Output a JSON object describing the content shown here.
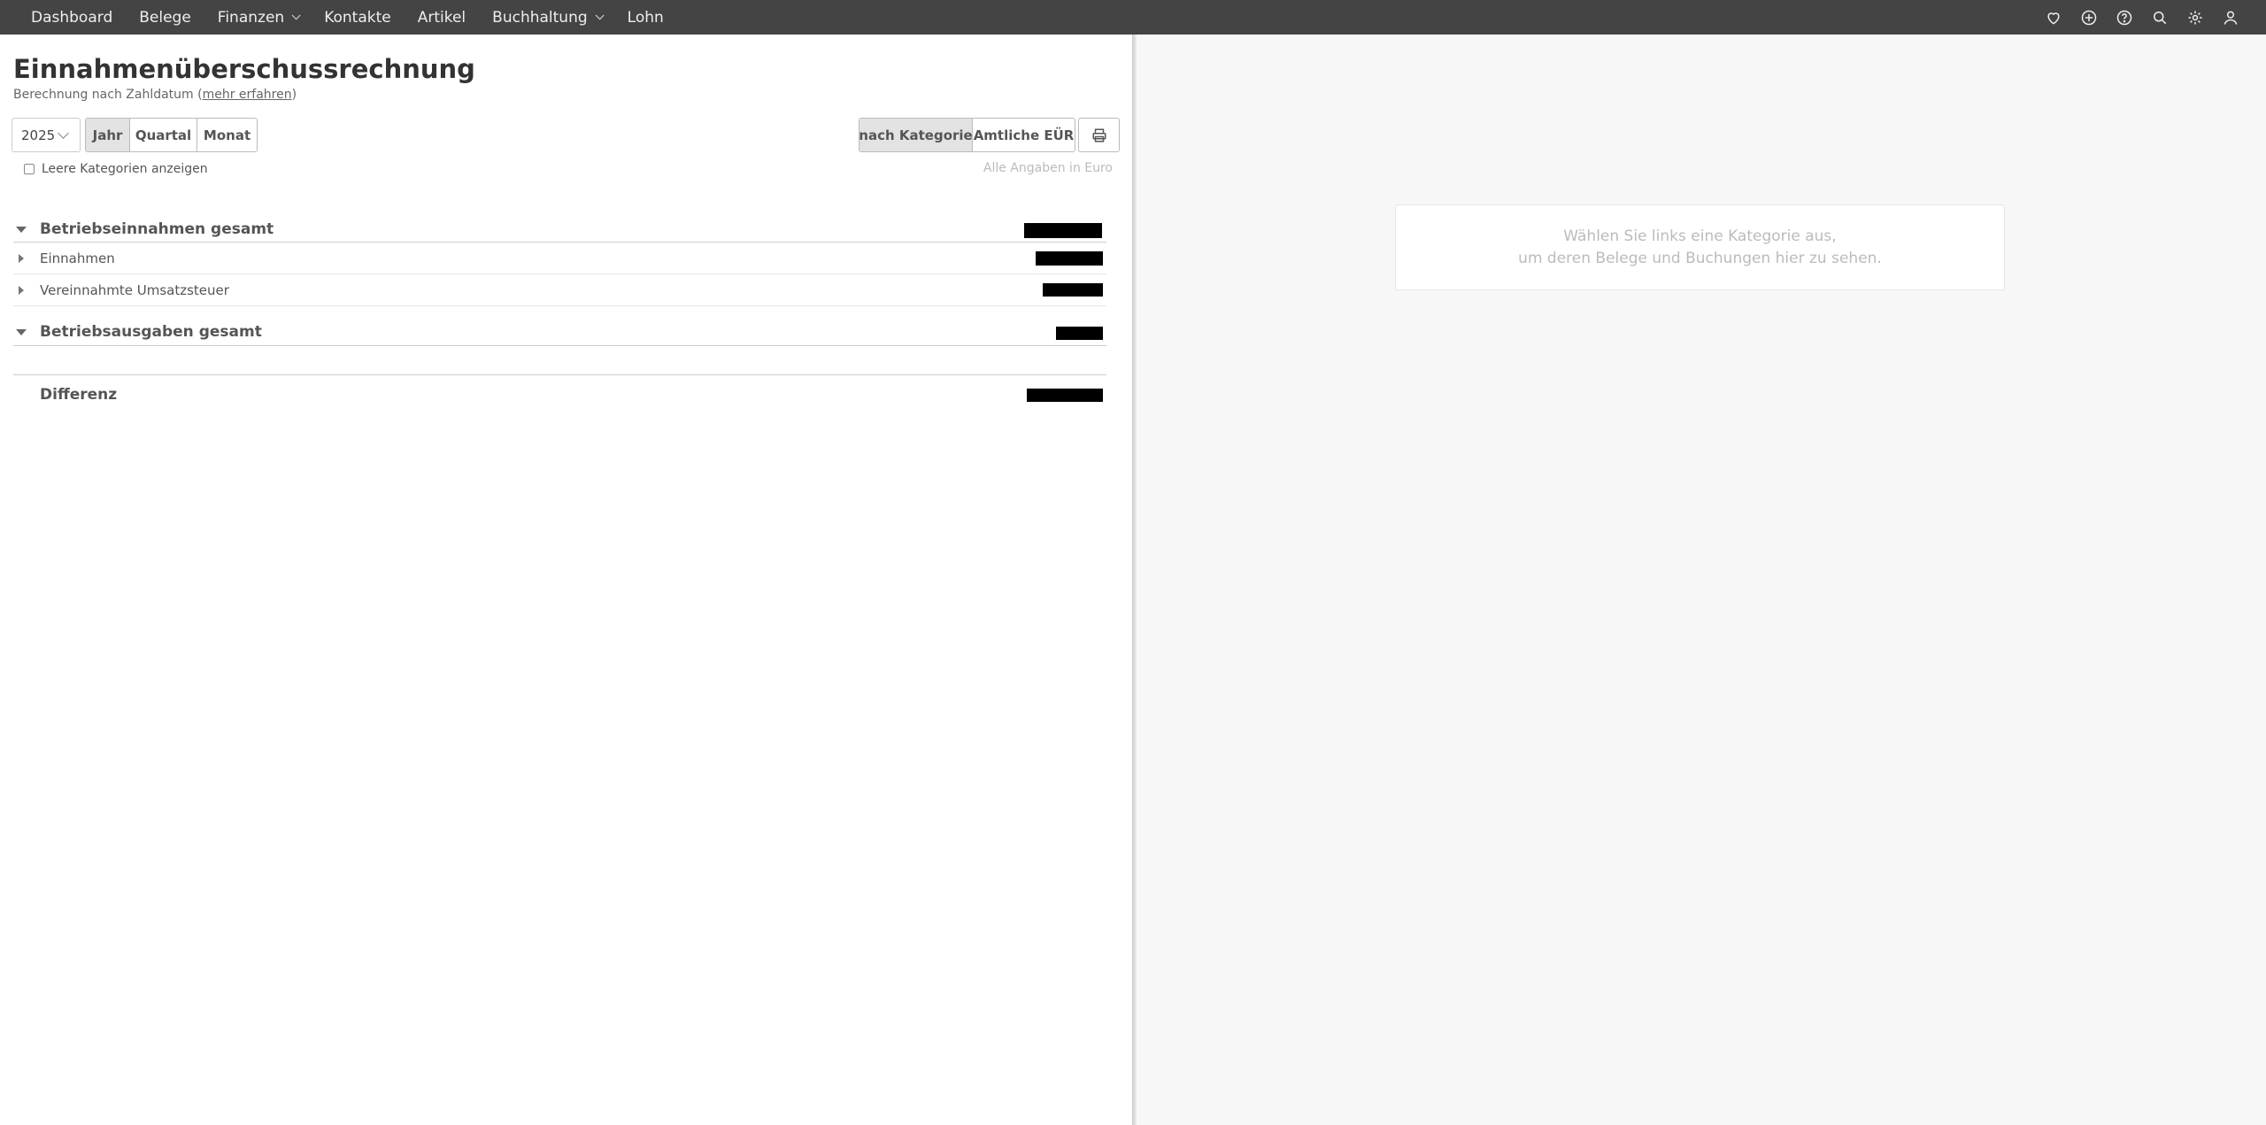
{
  "nav": {
    "items": [
      {
        "label": "Dashboard",
        "dropdown": false
      },
      {
        "label": "Belege",
        "dropdown": false
      },
      {
        "label": "Finanzen",
        "dropdown": true
      },
      {
        "label": "Kontakte",
        "dropdown": false
      },
      {
        "label": "Artikel",
        "dropdown": false
      },
      {
        "label": "Buchhaltung",
        "dropdown": true
      },
      {
        "label": "Lohn",
        "dropdown": false
      }
    ],
    "icons": [
      "heart-icon",
      "plus-circle-icon",
      "help-icon",
      "search-icon",
      "gear-icon",
      "user-icon"
    ]
  },
  "page": {
    "title": "Einnahmenüberschussrechnung",
    "subtitle_prefix": "Berechnung nach Zahldatum (",
    "subtitle_link": "mehr erfahren",
    "subtitle_suffix": ")"
  },
  "filters": {
    "year": "2025",
    "periods": [
      "Jahr",
      "Quartal",
      "Monat"
    ],
    "active_period": "Jahr",
    "views": [
      "nach Kategorie",
      "Amtliche EÜR"
    ],
    "active_view": "nach Kategorie",
    "empty_categories_label": "Leere Kategorien anzeigen",
    "euro_note": "Alle Angaben in Euro"
  },
  "report": {
    "income_total": "Betriebseinnahmen gesamt",
    "income_rows": [
      "Einnahmen",
      "Vereinnahmte Umsatzsteuer"
    ],
    "expenses_total": "Betriebsausgaben gesamt",
    "difference": "Differenz"
  },
  "detail": {
    "line1": "Wählen Sie links eine Kategorie aus,",
    "line2": "um deren Belege und Buchungen hier zu sehen."
  },
  "colors": {
    "topbar": "#444444",
    "redaction": "#000000"
  }
}
